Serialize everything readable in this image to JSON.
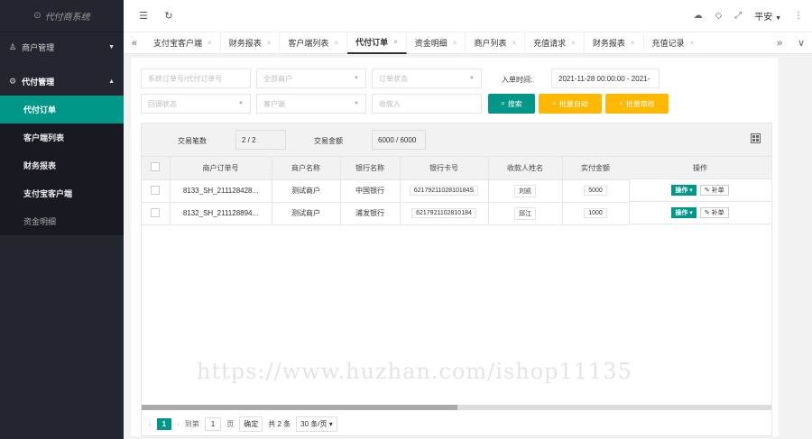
{
  "app_title": "代付商系统",
  "header": {
    "user": "平安"
  },
  "sidebar": {
    "groups": [
      {
        "label": "商户管理"
      },
      {
        "label": "代付管理"
      }
    ],
    "items": [
      {
        "label": "代付订单"
      },
      {
        "label": "客户端列表"
      },
      {
        "label": "财务报表"
      },
      {
        "label": "支付宝客户端"
      },
      {
        "label": "资金明细"
      }
    ]
  },
  "tabs": [
    {
      "label": "支付宝客户端"
    },
    {
      "label": "财务报表"
    },
    {
      "label": "客户端列表"
    },
    {
      "label": "代付订单"
    },
    {
      "label": "资金明细"
    },
    {
      "label": "商户列表"
    },
    {
      "label": "充值请求"
    },
    {
      "label": "财务报表"
    },
    {
      "label": "充值记录"
    }
  ],
  "filters": {
    "order_no_placeholder": "系统订单号/代付订单号",
    "merchant": "全部商户",
    "order_status": "订单状态",
    "time_label": "入单时间:",
    "time_value": "2021-11-28 00:00:00 - 2021-",
    "callback_status": "回调状态",
    "client": "客户端",
    "payee_placeholder": "收款人",
    "search_btn": "搜索",
    "batch_auto_btn": "批量自动",
    "batch_review_btn": "批量审核"
  },
  "stats": {
    "count_label": "交易笔数",
    "count_value": "2 / 2",
    "amount_label": "交易金额",
    "amount_value": "6000 / 6000 "
  },
  "table": {
    "headers": [
      "商户订单号",
      "商户名称",
      "银行名称",
      "银行卡号",
      "收款人姓名",
      "实付金额",
      "操作"
    ],
    "rows": [
      {
        "order_no": "8133_SH_211128428...",
        "merchant": "测试商户",
        "bank": "中国银行",
        "card": "6217921102810184S",
        "payee": "刘凯",
        "amount": "5000"
      },
      {
        "order_no": "8132_SH_211128894...",
        "merchant": "测试商户",
        "bank": "浦发银行",
        "card": "6217921102810184",
        "payee": "邱江",
        "amount": "1000"
      }
    ],
    "op_label": "操作",
    "fix_label": "补单"
  },
  "pager": {
    "current": "1",
    "goto_label": "到第",
    "page_input": "1",
    "page_unit": "页",
    "confirm": "确定",
    "total": "共 2 条",
    "per_page": "30 条/页"
  },
  "watermark": "https://www.huzhan.com/ishop11135"
}
